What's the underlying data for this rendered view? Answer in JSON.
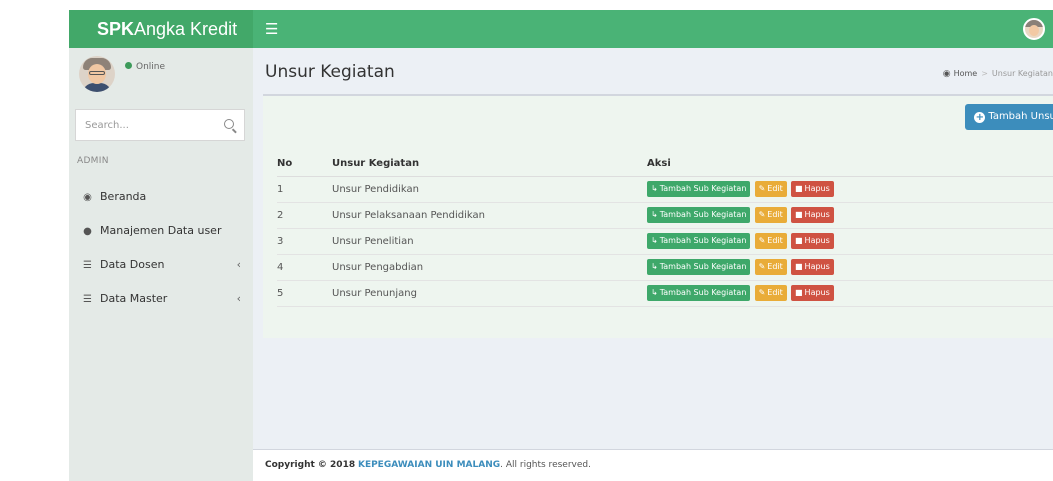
{
  "app": {
    "logo_bold": "SPK",
    "logo_rest": "Angka Kredit",
    "menu_toggle_icon": "hamburger-icon",
    "accent_color": "#4ab376"
  },
  "sidebar": {
    "status": "Online",
    "search_placeholder": "Search...",
    "section_header": "ADMIN",
    "items": [
      {
        "icon": "dashboard-icon",
        "label": "Beranda",
        "has_submenu": false
      },
      {
        "icon": "users-icon",
        "label": "Manajemen Data user",
        "has_submenu": false
      },
      {
        "icon": "list-icon",
        "label": "Data Dosen",
        "has_submenu": true
      },
      {
        "icon": "list-icon",
        "label": "Data Master",
        "has_submenu": true
      }
    ]
  },
  "page": {
    "title": "Unsur Kegiatan",
    "breadcrumb": {
      "home": "Home",
      "current": "Unsur Kegiatan"
    }
  },
  "box": {
    "add_button": "Tambah Unsur",
    "columns": [
      "No",
      "Unsur Kegiatan",
      "Aksi"
    ],
    "rows": [
      {
        "no": "1",
        "name": "Unsur Pendidikan"
      },
      {
        "no": "2",
        "name": "Unsur Pelaksanaan Pendidikan"
      },
      {
        "no": "3",
        "name": "Unsur Penelitian"
      },
      {
        "no": "4",
        "name": "Unsur Pengabdian"
      },
      {
        "no": "5",
        "name": "Unsur Penunjang"
      }
    ],
    "actions": {
      "sub": "Tambah Sub Kegiatan",
      "edit": "Edit",
      "delete": "Hapus"
    }
  },
  "footer": {
    "copyright": "Copyright © 2018",
    "org": "KEPEGAWAIAN UIN MALANG",
    "rights": ". All rights reserved."
  }
}
